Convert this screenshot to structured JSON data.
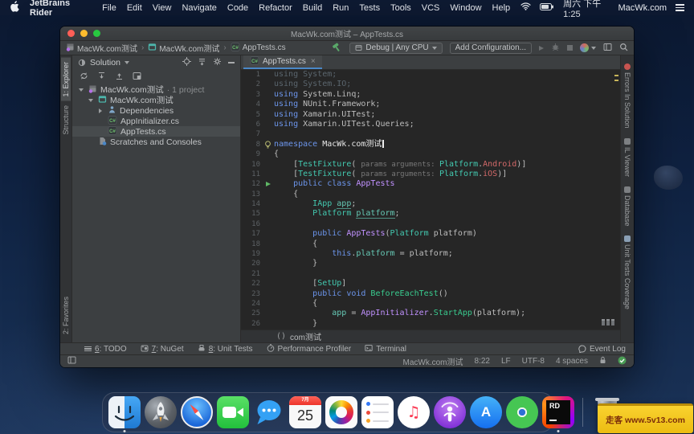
{
  "menu_bar": {
    "app_name": "JetBrains Rider",
    "menus": [
      "File",
      "Edit",
      "View",
      "Navigate",
      "Code",
      "Refactor",
      "Build",
      "Run",
      "Tests",
      "Tools",
      "VCS",
      "Window",
      "Help"
    ],
    "status_right": {
      "time": "周六 下午1:25",
      "site": "MacWk.com"
    }
  },
  "window": {
    "title": "MacWk.com测试 – AppTests.cs",
    "breadcrumbs": [
      {
        "icon": "solution",
        "label": "MacWk.com测试"
      },
      {
        "icon": "project",
        "label": "MacWk.com测试"
      },
      {
        "icon": "csharp",
        "label": "AppTests.cs"
      }
    ],
    "toolbar": {
      "run_config": "Debug | Any CPU",
      "add_config": "Add Configuration..."
    },
    "left_strip": {
      "top": [
        {
          "label": "1: Explorer",
          "active": true
        },
        {
          "label": "Structure",
          "active": false
        }
      ],
      "bottom": [
        {
          "label": "2: Favorites",
          "active": false
        }
      ]
    },
    "right_strip": [
      {
        "label": "Errors In Solution",
        "icon": "err"
      },
      {
        "label": "IL Viewer",
        "icon": "plain"
      },
      {
        "label": "Database",
        "icon": "plain"
      },
      {
        "label": "Unit Tests Coverage",
        "icon": "fold"
      }
    ],
    "solution_panel": {
      "header_label": "Solution",
      "tree": [
        {
          "label": "MacWk.com测试",
          "suffix": " · 1 project",
          "icon": "solution",
          "indent": 0,
          "arrow": "down",
          "selected": false
        },
        {
          "label": "MacWk.com测试",
          "suffix": "",
          "icon": "project",
          "indent": 1,
          "arrow": "down",
          "selected": false
        },
        {
          "label": "Dependencies",
          "suffix": "",
          "icon": "deps",
          "indent": 2,
          "arrow": "right",
          "selected": false
        },
        {
          "label": "AppInitializer.cs",
          "suffix": "",
          "icon": "csharp",
          "indent": 2,
          "arrow": "",
          "selected": false
        },
        {
          "label": "AppTests.cs",
          "suffix": "",
          "icon": "csharp",
          "indent": 2,
          "arrow": "",
          "selected": true
        },
        {
          "label": "Scratches and Consoles",
          "suffix": "",
          "icon": "scratches",
          "indent": 1,
          "arrow": "",
          "selected": false
        }
      ]
    },
    "editor": {
      "tab_label": "AppTests.cs",
      "tab_close": "×",
      "bottom_breadcrumb_paren": "()",
      "bottom_breadcrumb": "com测试",
      "lines": [
        {
          "n": "1",
          "g": "",
          "s": [
            [
              "d",
              "using System;"
            ]
          ]
        },
        {
          "n": "2",
          "g": "",
          "s": [
            [
              "d",
              "using System.IO;"
            ]
          ]
        },
        {
          "n": "3",
          "g": "",
          "s": [
            [
              "k",
              "using "
            ],
            [
              "p",
              "System.Linq;"
            ]
          ]
        },
        {
          "n": "4",
          "g": "",
          "s": [
            [
              "k",
              "using "
            ],
            [
              "p",
              "NUnit.Framework;"
            ]
          ]
        },
        {
          "n": "5",
          "g": "",
          "s": [
            [
              "k",
              "using "
            ],
            [
              "p",
              "Xamarin.UITest;"
            ]
          ]
        },
        {
          "n": "6",
          "g": "",
          "s": [
            [
              "k",
              "using "
            ],
            [
              "p",
              "Xamarin.UITest.Queries;"
            ]
          ]
        },
        {
          "n": "7",
          "g": "",
          "s": []
        },
        {
          "n": "8",
          "g": "bulb",
          "s": [
            [
              "k",
              "namespace "
            ],
            [
              "w",
              "MacWk.com测试"
            ],
            [
              "cursor",
              ""
            ]
          ]
        },
        {
          "n": "9",
          "g": "",
          "s": [
            [
              "p",
              "{"
            ]
          ]
        },
        {
          "n": "10",
          "g": "",
          "s": [
            [
              "p",
              "    ["
            ],
            [
              "t",
              "TestFixture"
            ],
            [
              "p",
              "( "
            ],
            [
              "h",
              "params arguments: "
            ],
            [
              "t",
              "Platform"
            ],
            [
              "p",
              "."
            ],
            [
              "e",
              "Android"
            ],
            [
              "p",
              ")]"
            ]
          ]
        },
        {
          "n": "11",
          "g": "",
          "s": [
            [
              "p",
              "    ["
            ],
            [
              "t",
              "TestFixture"
            ],
            [
              "p",
              "( "
            ],
            [
              "h",
              "params arguments: "
            ],
            [
              "t",
              "Platform"
            ],
            [
              "p",
              "."
            ],
            [
              "e",
              "iOS"
            ],
            [
              "p",
              ")]"
            ]
          ]
        },
        {
          "n": "12",
          "g": "play",
          "s": [
            [
              "p",
              "    "
            ],
            [
              "k",
              "public class "
            ],
            [
              "c",
              "AppTests"
            ]
          ]
        },
        {
          "n": "13",
          "g": "",
          "s": [
            [
              "p",
              "    {"
            ]
          ]
        },
        {
          "n": "14",
          "g": "",
          "s": [
            [
              "p",
              "        "
            ],
            [
              "t",
              "IApp "
            ],
            [
              "f",
              "app"
            ],
            [
              "p",
              ";"
            ]
          ]
        },
        {
          "n": "15",
          "g": "",
          "s": [
            [
              "p",
              "        "
            ],
            [
              "t",
              "Platform "
            ],
            [
              "f",
              "platform"
            ],
            [
              "p",
              ";"
            ]
          ]
        },
        {
          "n": "16",
          "g": "",
          "s": []
        },
        {
          "n": "17",
          "g": "",
          "s": [
            [
              "p",
              "        "
            ],
            [
              "k",
              "public "
            ],
            [
              "c",
              "AppTests"
            ],
            [
              "p",
              "("
            ],
            [
              "t",
              "Platform"
            ],
            [
              "p",
              " platform)"
            ]
          ]
        },
        {
          "n": "18",
          "g": "",
          "s": [
            [
              "p",
              "        {"
            ]
          ]
        },
        {
          "n": "19",
          "g": "",
          "s": [
            [
              "p",
              "            "
            ],
            [
              "k",
              "this"
            ],
            [
              "p",
              "."
            ],
            [
              "v",
              "platform"
            ],
            [
              "p",
              " = platform;"
            ]
          ]
        },
        {
          "n": "20",
          "g": "",
          "s": [
            [
              "p",
              "        }"
            ]
          ]
        },
        {
          "n": "21",
          "g": "",
          "s": []
        },
        {
          "n": "22",
          "g": "",
          "s": [
            [
              "p",
              "        ["
            ],
            [
              "t",
              "SetUp"
            ],
            [
              "p",
              "]"
            ]
          ]
        },
        {
          "n": "23",
          "g": "",
          "s": [
            [
              "p",
              "        "
            ],
            [
              "k",
              "public void "
            ],
            [
              "m",
              "BeforeEachTest"
            ],
            [
              "p",
              "()"
            ]
          ]
        },
        {
          "n": "24",
          "g": "",
          "s": [
            [
              "p",
              "        {"
            ]
          ]
        },
        {
          "n": "25",
          "g": "",
          "s": [
            [
              "p",
              "            "
            ],
            [
              "v",
              "app"
            ],
            [
              "p",
              " = "
            ],
            [
              "c",
              "AppInitializer"
            ],
            [
              "p",
              "."
            ],
            [
              "m",
              "StartApp"
            ],
            [
              "p",
              "(platform);"
            ]
          ]
        },
        {
          "n": "26",
          "g": "",
          "s": [
            [
              "p",
              "        }"
            ]
          ]
        }
      ]
    },
    "bottom_bar": {
      "items": [
        {
          "num": "6",
          "label": "TODO",
          "icon": "todo"
        },
        {
          "num": "7",
          "label": "NuGet",
          "icon": "nuget"
        },
        {
          "num": "8",
          "label": "Unit Tests",
          "icon": "unit"
        },
        {
          "num": "",
          "label": "Performance Profiler",
          "icon": "perf"
        },
        {
          "num": "",
          "label": "Terminal",
          "icon": "term"
        }
      ],
      "event_log": "Event Log"
    },
    "status_bar": {
      "items": [
        "MacWk.com测试",
        "8:22",
        "LF",
        "UTF-8",
        "4 spaces"
      ]
    }
  },
  "icons": {
    "csharp_badge": "C#"
  },
  "dock": {
    "items": [
      {
        "name": "finder",
        "running": true
      },
      {
        "name": "launchpad",
        "running": false
      },
      {
        "name": "safari",
        "running": false
      },
      {
        "name": "facetime",
        "running": false
      },
      {
        "name": "messages",
        "running": false
      },
      {
        "name": "calendar",
        "running": false,
        "month": "7月",
        "day": "25"
      },
      {
        "name": "photos",
        "running": false
      },
      {
        "name": "reminders",
        "running": false
      },
      {
        "name": "music",
        "running": false
      },
      {
        "name": "podcasts",
        "running": false
      },
      {
        "name": "app-store",
        "running": false,
        "letter": "A"
      },
      {
        "name": "disc",
        "running": false
      },
      {
        "name": "rider",
        "running": true,
        "label": "RD"
      },
      {
        "name": "trash",
        "running": false
      }
    ]
  },
  "watermark": {
    "text": "走客 www.5v13.com"
  }
}
